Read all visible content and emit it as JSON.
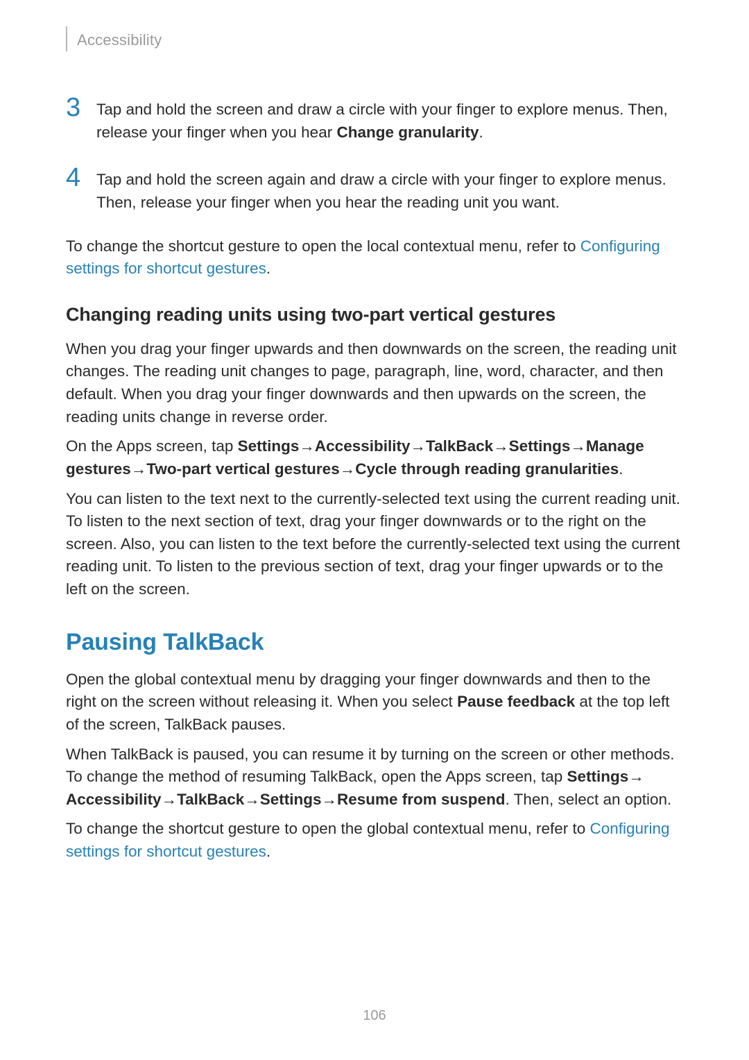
{
  "header": {
    "section": "Accessibility"
  },
  "steps": {
    "s3": {
      "num": "3",
      "t1": "Tap and hold the screen and draw a circle with your finger to explore menus. Then, release your finger when you hear ",
      "b1": "Change granularity",
      "t2": "."
    },
    "s4": {
      "num": "4",
      "t1": "Tap and hold the screen again and draw a circle with your finger to explore menus. Then, release your finger when you hear the reading unit you want."
    }
  },
  "p_after_steps": {
    "t1": "To change the shortcut gesture to open the local contextual menu, refer to ",
    "link": "Configuring settings for shortcut gestures",
    "t2": "."
  },
  "heading_sub": "Changing reading units using two-part vertical gestures",
  "p_sub1": "When you drag your finger upwards and then downwards on the screen, the reading unit changes. The reading unit changes to page, paragraph, line, word, character, and then default. When you drag your finger downwards and then upwards on the screen, the reading units change in reverse order.",
  "p_sub2": {
    "t1": "On the Apps screen, tap ",
    "b1": "Settings",
    "arr": " → ",
    "b2": "Accessibility",
    "b3": "TalkBack",
    "b4": "Settings",
    "b5": "Manage gestures",
    "b6": "Two-part vertical gestures",
    "b7": "Cycle through reading granularities",
    "end": "."
  },
  "p_sub3": "You can listen to the text next to the currently-selected text using the current reading unit. To listen to the next section of text, drag your finger downwards or to the right on the screen. Also, you can listen to the text before the currently-selected text using the current reading unit. To listen to the previous section of text, drag your finger upwards or to the left on the screen.",
  "heading_section": "Pausing TalkBack",
  "p_sec1": {
    "t1": "Open the global contextual menu by dragging your finger downwards and then to the right on the screen without releasing it. When you select ",
    "b1": "Pause feedback",
    "t2": " at the top left of the screen, TalkBack pauses."
  },
  "p_sec2": {
    "t1": "When TalkBack is paused, you can resume it by turning on the screen or other methods. To change the method of resuming TalkBack, open the Apps screen, tap ",
    "b1": "Settings",
    "arr": " → ",
    "b2": "Accessibility",
    "b3": "TalkBack",
    "b4": "Settings",
    "b5": "Resume from suspend",
    "t2": ". Then, select an option."
  },
  "p_sec3": {
    "t1": "To change the shortcut gesture to open the global contextual menu, refer to ",
    "link": "Configuring settings for shortcut gestures",
    "t2": "."
  },
  "page_number": "106"
}
